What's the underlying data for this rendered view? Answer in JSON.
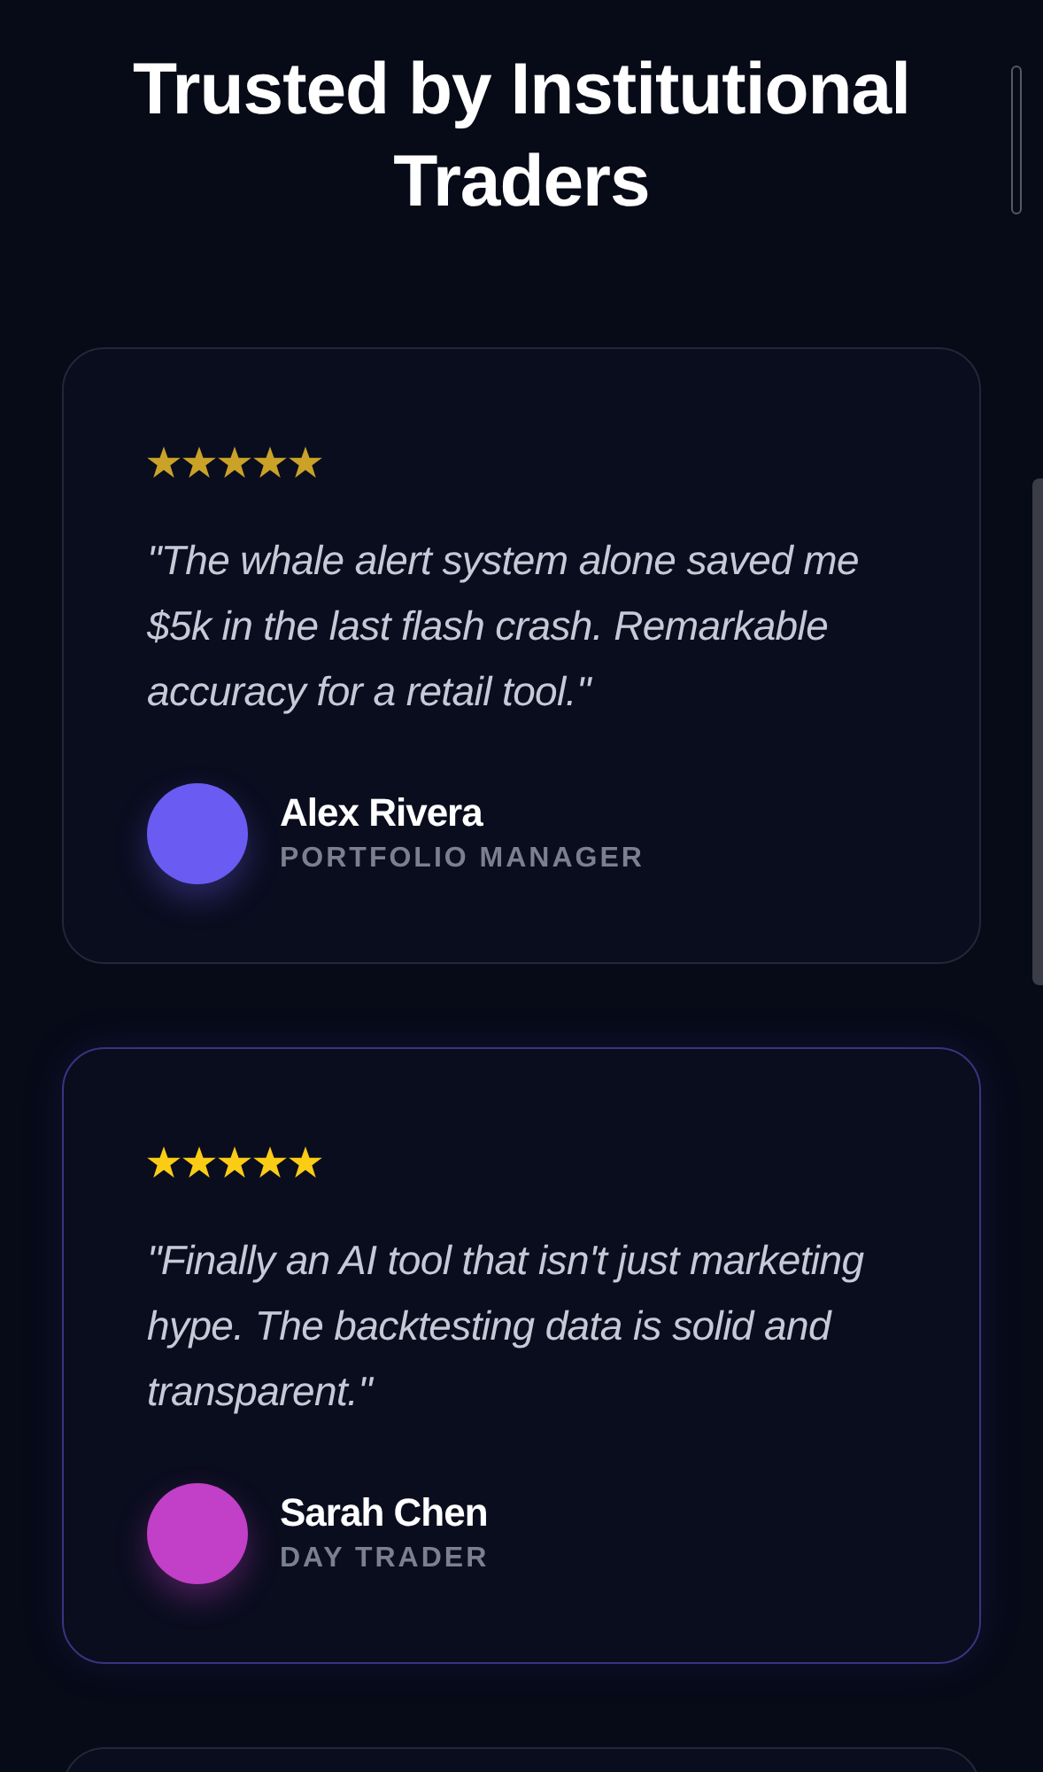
{
  "heading": "Trusted by Institutional Traders",
  "testimonials": [
    {
      "stars": 5,
      "highlighted": false,
      "quote": "\"The whale alert system alone saved me $5k in the last flash crash. Remarkable accuracy for a retail tool.\"",
      "name": "Alex Rivera",
      "role": "PORTFOLIO MANAGER",
      "avatar": {
        "color": "#6a5cf2"
      }
    },
    {
      "stars": 5,
      "highlighted": true,
      "quote": "\"Finally an AI tool that isn't just marketing hype. The backtesting data is solid and transparent.\"",
      "name": "Sarah Chen",
      "role": "DAY TRADER",
      "avatar": {
        "color": "#c23fc8"
      }
    }
  ]
}
